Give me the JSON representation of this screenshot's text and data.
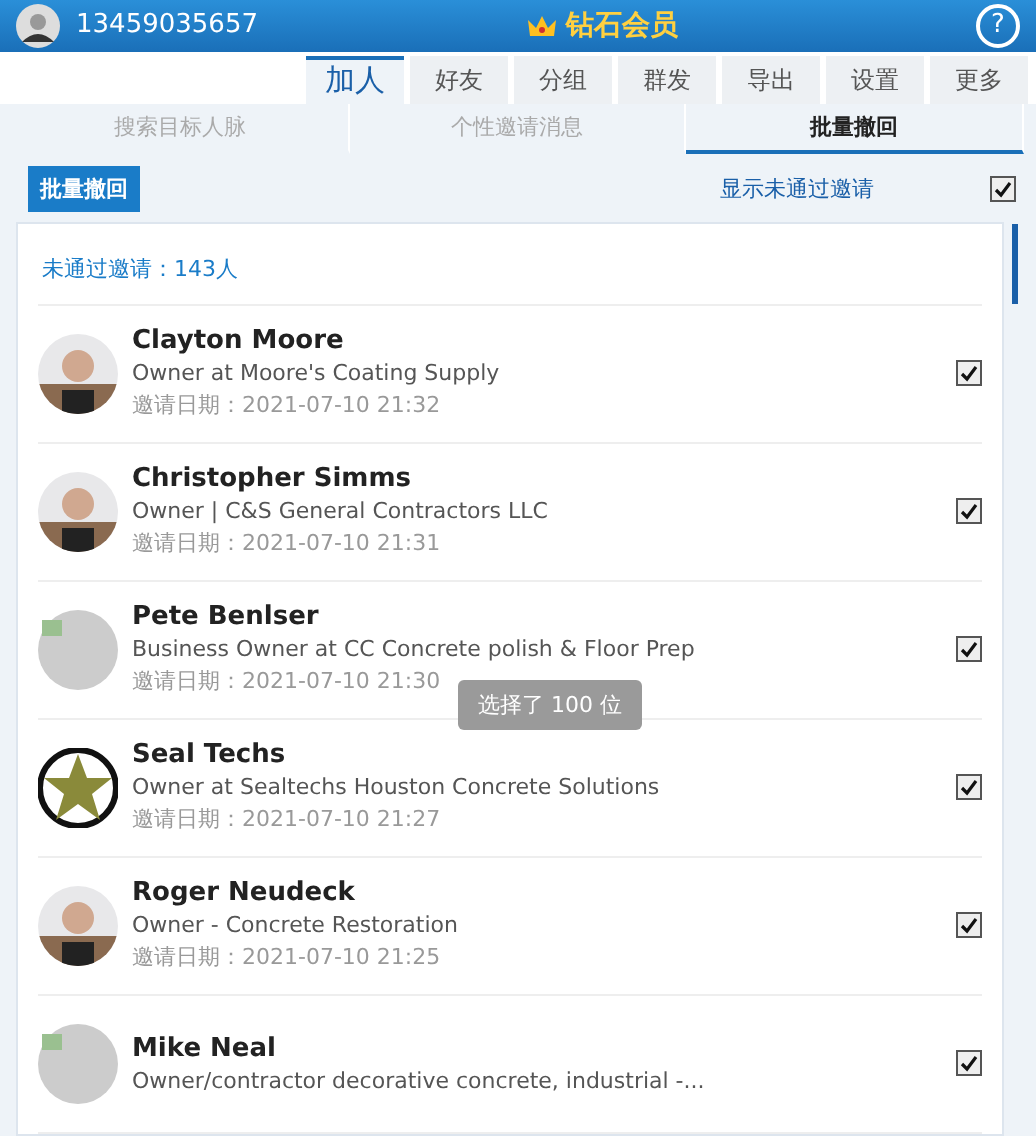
{
  "header": {
    "phone": "13459035657",
    "title": "钻石会员",
    "help": "?"
  },
  "tabs": [
    {
      "label": "加人",
      "selected": true
    },
    {
      "label": "好友",
      "selected": false
    },
    {
      "label": "分组",
      "selected": false
    },
    {
      "label": "群发",
      "selected": false
    },
    {
      "label": "导出",
      "selected": false
    },
    {
      "label": "设置",
      "selected": false
    },
    {
      "label": "更多",
      "selected": false
    }
  ],
  "subtabs": [
    {
      "label": "搜索目标人脉",
      "selected": false
    },
    {
      "label": "个性邀请消息",
      "selected": false
    },
    {
      "label": "批量撤回",
      "selected": true
    }
  ],
  "toolbar": {
    "button": "批量撤回",
    "toggle_label": "显示未通过邀请",
    "toggle_checked": true
  },
  "count": "未通过邀请：143人",
  "contacts": [
    {
      "name": "Clayton Moore",
      "title": "Owner at Moore's Coating Supply",
      "date": "邀请日期：2021-07-10 21:32",
      "kind": "picture",
      "checked": true
    },
    {
      "name": "Christopher Simms",
      "title": "Owner | C&S General Contractors LLC",
      "date": "邀请日期：2021-07-10 21:31",
      "kind": "picture",
      "checked": true
    },
    {
      "name": "Pete Benlser",
      "title": "Business Owner at CC Concrete polish & Floor Prep",
      "date": "邀请日期：2021-07-10 21:30",
      "kind": "broken",
      "checked": true
    },
    {
      "name": "Seal Techs",
      "title": "Owner at Sealtechs Houston Concrete Solutions",
      "date": "邀请日期：2021-07-10 21:27",
      "kind": "star",
      "checked": true
    },
    {
      "name": "Roger Neudeck",
      "title": "Owner - Concrete Restoration",
      "date": "邀请日期：2021-07-10 21:25",
      "kind": "picture",
      "checked": true
    },
    {
      "name": "Mike Neal",
      "title": "Owner/contractor decorative concrete, industrial -...",
      "kind": "broken",
      "checked": true
    }
  ],
  "toast": "选择了 100 位"
}
